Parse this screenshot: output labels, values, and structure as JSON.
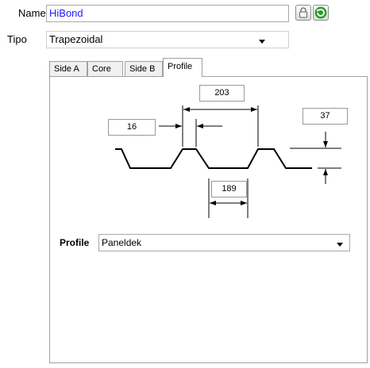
{
  "form": {
    "name_label": "Name",
    "name_value": "HiBond",
    "tipo_label": "Tipo",
    "tipo_value": "Trapezoidal",
    "lock_icon": "lock-icon",
    "refresh_icon": "refresh-icon",
    "name_color": "#0000ff"
  },
  "tabs": [
    {
      "label": "Side A"
    },
    {
      "label": "Core"
    },
    {
      "label": "Side B"
    },
    {
      "label": "Profile"
    }
  ],
  "active_tab": "Profile",
  "profile": {
    "dim_203": "203",
    "dim_16": "16",
    "dim_37": "37",
    "dim_189": "189",
    "profile_label": "Profile",
    "profile_value": "Paneldek"
  }
}
